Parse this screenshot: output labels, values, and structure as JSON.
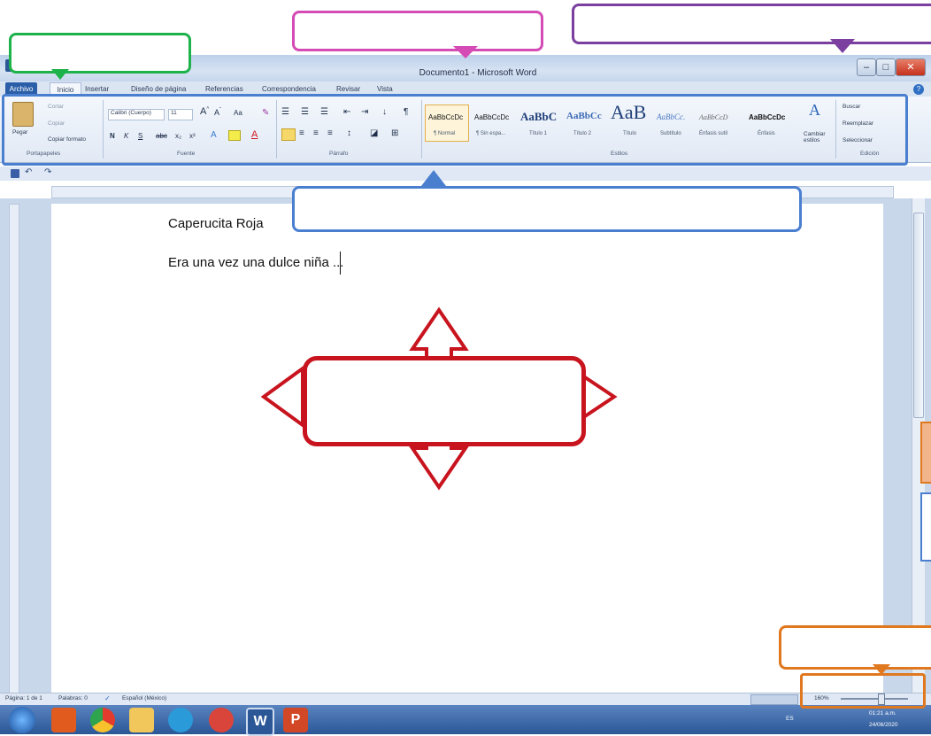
{
  "window": {
    "title": "Documento1 - Microsoft Word",
    "min": "–",
    "max": "□",
    "close": "✕"
  },
  "tabs": [
    "Archivo",
    "Inicio",
    "Insertar",
    "Diseño de página",
    "Referencias",
    "Correspondencia",
    "Revisar",
    "Vista"
  ],
  "ribbon": {
    "clipboard": {
      "paste": "Pegar",
      "cut": "Cortar",
      "copy": "Copiar",
      "format": "Copiar formato",
      "label": "Portapapeles"
    },
    "font": {
      "name": "Calibri (Cuerpo)",
      "size": "11",
      "label": "Fuente"
    },
    "paragraph": {
      "label": "Párrafo"
    },
    "styles": {
      "items": [
        {
          "preview": "AaBbCcDc",
          "name": "¶ Normal"
        },
        {
          "preview": "AaBbCcDc",
          "name": "¶ Sin espa..."
        },
        {
          "preview": "AaBbC",
          "name": "Título 1"
        },
        {
          "preview": "AaBbCc",
          "name": "Título 2"
        },
        {
          "preview": "AaB",
          "name": "Título"
        },
        {
          "preview": "AaBbCc.",
          "name": "Subtítulo"
        },
        {
          "preview": "AaBbCcD",
          "name": "Énfasis sutil"
        },
        {
          "preview": "AaBbCcDc",
          "name": "Énfasis"
        }
      ],
      "change": "Cambiar estilos",
      "label": "Estilos"
    },
    "editing": {
      "find": "Buscar",
      "replace": "Reemplazar",
      "select": "Seleccionar",
      "label": "Edición"
    }
  },
  "document": {
    "line1": "Caperucita Roja",
    "line2": "Era una vez una dulce niña ..."
  },
  "status": {
    "page": "Página: 1 de 1",
    "words": "Palabras: 0",
    "lang": "Español (México)",
    "zoom": "160%"
  },
  "taskbar": {
    "lang": "ES",
    "time": "01:21 a.m.",
    "date": "24/06/2020"
  },
  "colors": {
    "green": "#1db24a",
    "pink": "#d54bb5",
    "purple": "#7b3fa0",
    "blue": "#4a7fd0",
    "red": "#c8141e",
    "orange": "#e07820"
  }
}
